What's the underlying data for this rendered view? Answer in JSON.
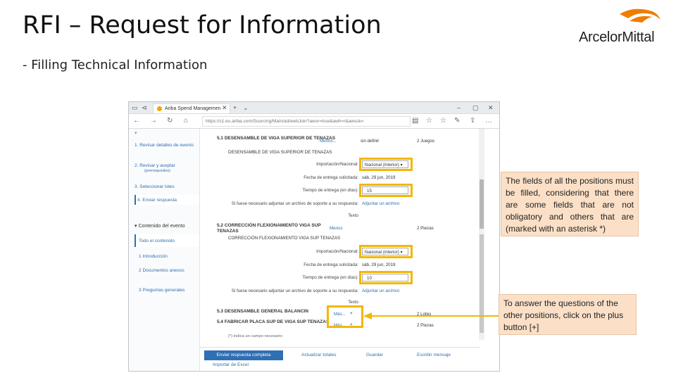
{
  "slide": {
    "title": "RFI – Request for Information",
    "subtitle": "- Filling Technical Information",
    "logo_text": "ArcelorMittal"
  },
  "browser": {
    "tab_label": "Ariba Spend Managemen",
    "url": "https://s1.eu.ariba.com/Sourcing/Main/ad/webJoin?awsr=true&awh=r&awssk=",
    "sidebar": {
      "steps": [
        {
          "num": "1.",
          "label": "Revisar detalles de evento"
        },
        {
          "num": "2.",
          "label": "Revisar y aceptar",
          "sub": "(prerrequisitos)"
        },
        {
          "num": "3.",
          "label": "Seleccionar lotes"
        },
        {
          "num": "4.",
          "label": "Enviar respuesta"
        }
      ],
      "section_header": "Contenido del evento",
      "content_items": [
        {
          "num": "",
          "label": "Todo el contenido"
        },
        {
          "num": "1",
          "label": "Introducción"
        },
        {
          "num": "2",
          "label": "Documentos anexos"
        },
        {
          "num": "3",
          "label": "Preguntas generales"
        }
      ]
    },
    "items": [
      {
        "title": "5.1  DESENSAMBLE DE VIGA SUPERIOR DE TENAZAS",
        "subtitle": "DESENSAMBLE DE VIGA SUPERIOR DE TENAZAS",
        "menu_label": "Menos...",
        "qty_label": "sin definir",
        "qty": "2 Juegos",
        "import_label": "Importación/Nacional:",
        "import_value": "Nacional (interior)",
        "date_label": "Fecha de entrega solicitada:",
        "date_value": "sáb, 29 jun, 2019",
        "lead_label": "Tiempo de entrega (en días):",
        "lead_value": "15",
        "attach_label": "Si fuese necesario adjuntar un archivo de soporte a su respuesta:",
        "attach_link": "Adjuntar un archivo",
        "text_label": "Texto"
      },
      {
        "title": "5.2  CORRECCIÓN FLEXIONAMIENTO VIGA SUP TENAZAS",
        "subtitle": "CORRECCIÓN FLEXIONAMIENTO VIGA SUP TENAZAS",
        "menu_label": "Menos",
        "qty": "2 Piezas",
        "import_label": "Importación/Nacional:",
        "import_value": "Nacional (interior)",
        "date_label": "Fecha de entrega solicitada:",
        "date_value": "sáb, 29 jun, 2019",
        "lead_label": "Tiempo de entrega (en días):",
        "lead_value": "10",
        "attach_label": "Si fuese necesario adjuntar un archivo de soporte a su respuesta:",
        "attach_link": "Adjuntar un archivo",
        "text_label": "Texto"
      },
      {
        "title": "5.3  DESENSAMBLE GENERAL BALANCIN",
        "menu_label": "Más...",
        "plus": "+",
        "qty": "2 Lotes"
      },
      {
        "title": "5.4  FABRICAR PLACA SUP DE VIGA SUP TENAZAS",
        "menu_label": "Más...",
        "plus": "+",
        "qty": "2 Piezas"
      }
    ],
    "required_note": "(*) indica un campo necesario",
    "buttons": {
      "submit": "Enviar respuesta completa",
      "update": "Actualizar totales",
      "save": "Guardar",
      "message": "Escribir mensaje",
      "import": "Importar de Excel"
    }
  },
  "notes": {
    "note1": "The fields of all the positions must be filled, considering that there are some fields that are not obligatory and others that are (marked with an asterisk *)",
    "note2": "To answer the questions of the other positions, click on the plus button [+]"
  },
  "colors": {
    "highlight": "#f2b705",
    "note_bg": "#fbe0c7",
    "logo_orange": "#f07d00",
    "link_blue": "#2f6fb3"
  }
}
